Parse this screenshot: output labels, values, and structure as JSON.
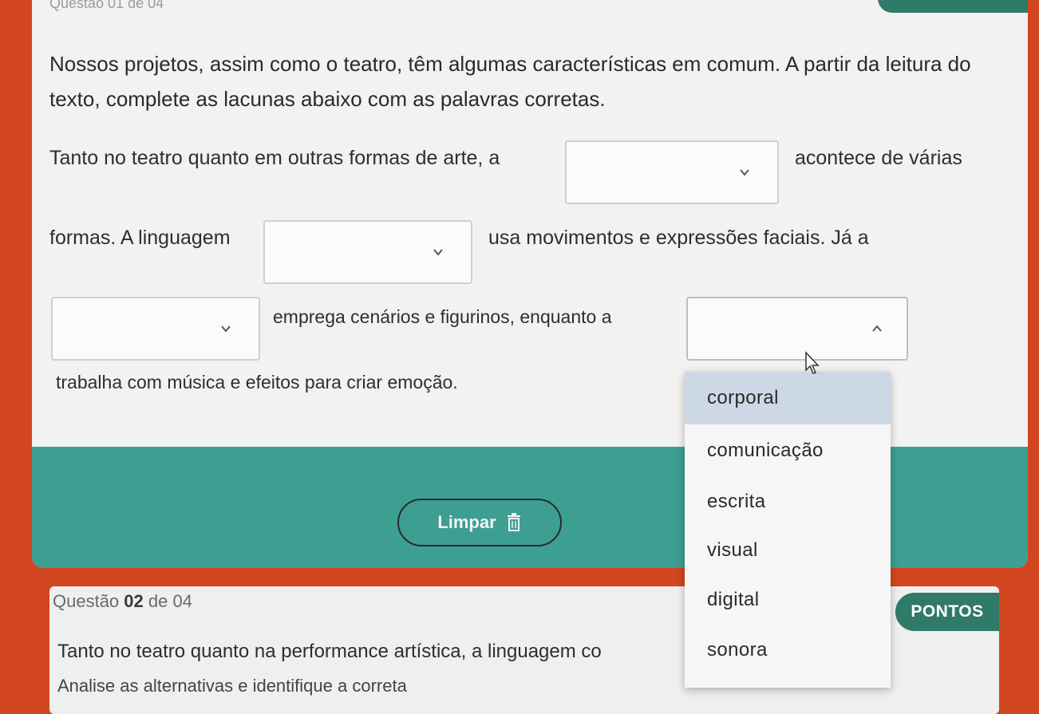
{
  "question1": {
    "header": "Questão 01 de 04",
    "prompt": "Nossos projetos, assim como o teatro, têm algumas características em comum. A partir da leitura do texto, complete as lacunas abaixo com as palavras corretas.",
    "sentence": {
      "part1": "Tanto no teatro quanto em outras formas de arte, a",
      "part2": "acontece de várias",
      "part3": "formas. A linguagem",
      "part4": "usa movimentos e expressões faciais. Já a",
      "part5": "emprega cenários e figurinos, enquanto a",
      "part6": "trabalha com música e efeitos para criar emoção."
    },
    "blanks": [
      {
        "value": "",
        "state": "closed"
      },
      {
        "value": "",
        "state": "closed"
      },
      {
        "value": "",
        "state": "closed"
      },
      {
        "value": "",
        "state": "open"
      }
    ],
    "dropdown_options": [
      {
        "label": "corporal",
        "highlighted": true
      },
      {
        "label": "comunicação",
        "highlighted": false
      },
      {
        "label": "escrita",
        "highlighted": false
      },
      {
        "label": "visual",
        "highlighted": false
      },
      {
        "label": "digital",
        "highlighted": false
      },
      {
        "label": "sonora",
        "highlighted": false
      }
    ],
    "clear_button_label": "Limpar"
  },
  "question2": {
    "header_prefix": "Questão",
    "number": "02",
    "header_suffix": "de 04",
    "points_label": "PONTOS",
    "text": "Tanto no teatro quanto na performance artística, a linguagem co",
    "subtext": "Analise as alternativas e identifique a correta"
  },
  "colors": {
    "background": "#d2461f",
    "card": "#f2f2f0",
    "teal": "#3d9f92",
    "dark_teal": "#2f7a68",
    "highlight": "#ccd8e6"
  }
}
